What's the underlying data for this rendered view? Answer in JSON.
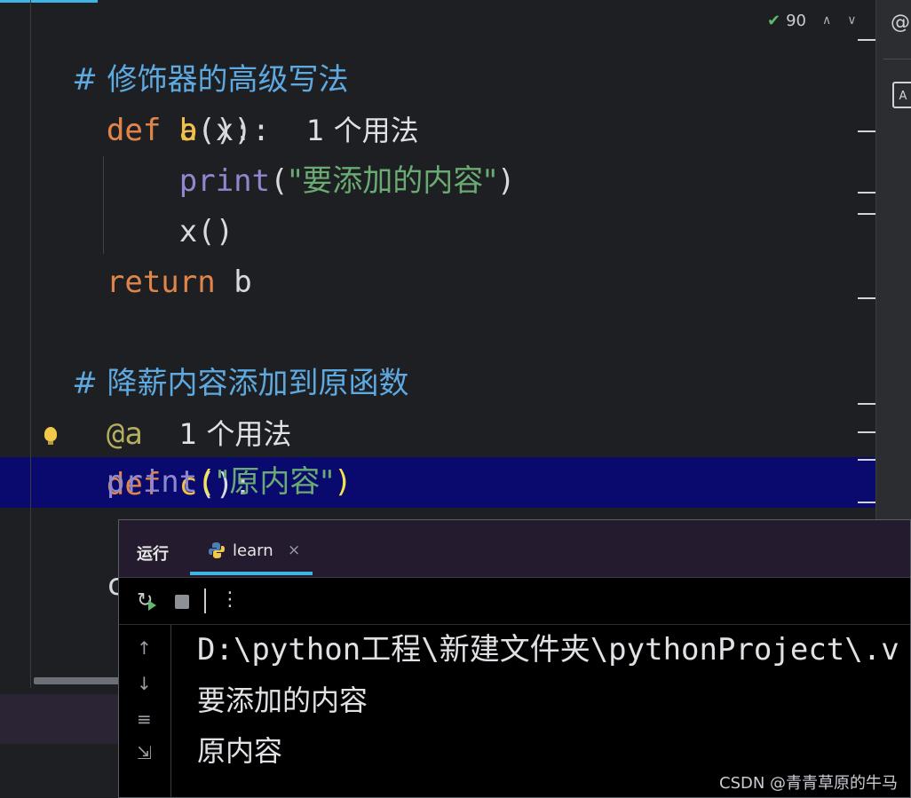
{
  "editor": {
    "inspections_count": "90",
    "lines": {
      "l1_comment": "# 修饰器的高级写法",
      "l2_def": "def",
      "l2_name": "a",
      "l2_rest": "(x):",
      "l2_hint": "1 个用法",
      "l3_def": "def",
      "l3_name": "b",
      "l3_rest": "():",
      "l4_print": "print",
      "l4_open": "(",
      "l4_str": "\"要添加的内容\"",
      "l4_close": ")",
      "l5_call": "x()",
      "l6_return": "return",
      "l6_value": "b",
      "l7_comment": "# 降薪内容添加到原函数",
      "l8_decorator": "@a",
      "l8_hint": "1 个用法",
      "l9_def": "def",
      "l9_name": "c",
      "l9_rest": "():",
      "l10_print": "print",
      "l10_open": "(",
      "l10_str": "\"原内容\"",
      "l10_close": ")",
      "l11_call": "c()"
    }
  },
  "run_panel": {
    "title": "运行",
    "tab_label": "learn",
    "tab_close": "×",
    "console": [
      "D:\\python工程\\新建文件夹\\pythonProject\\.v",
      "要添加的内容",
      "原内容"
    ]
  },
  "watermark": "CSDN @青青草原的牛马",
  "colors": {
    "keyword": "#e0854a",
    "function_name": "#f0c04a",
    "comment": "#5ea9e0",
    "string": "#6aab73",
    "builtin": "#8e89cf",
    "current_line": "#0a0a6e",
    "accent": "#3fb4e5"
  }
}
